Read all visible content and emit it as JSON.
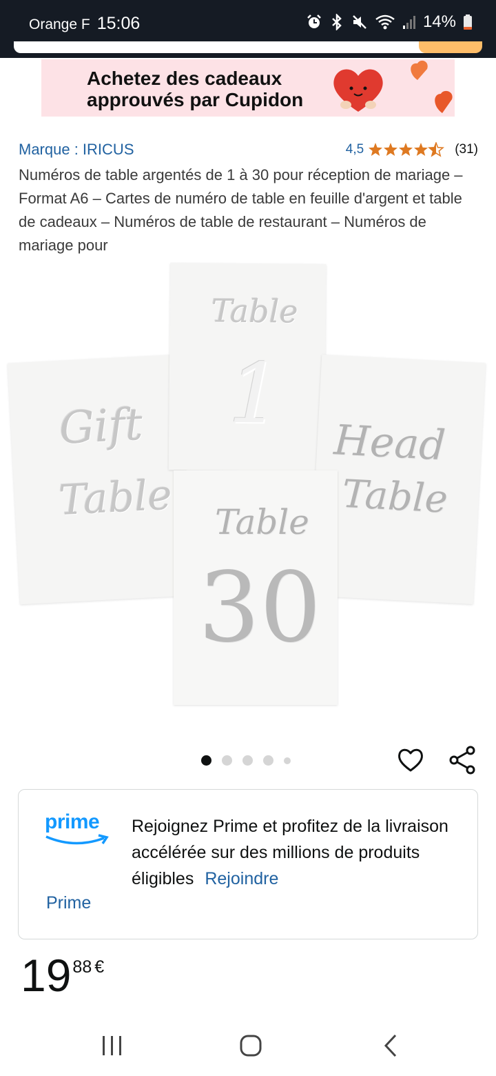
{
  "status_bar": {
    "carrier": "Orange F",
    "time": "15:06",
    "battery": "14%"
  },
  "promo": {
    "text": "Achetez des cadeaux\napprouvés par Cupidon"
  },
  "product": {
    "brand": "Marque : IRICUS",
    "rating_value": "4,5",
    "rating_stars": 4.5,
    "rating_count": "(31)",
    "title": "Numéros de table argentés de 1 à 30 pour réception de mariage – Format A6 – Cartes de numéro de table en feuille d'argent et table de cadeaux – Numéros de table de restaurant – Numéros de mariage pour",
    "image_cards": {
      "gift": [
        "Gift",
        "Table"
      ],
      "one": [
        "Table",
        "1"
      ],
      "head": [
        "Head",
        "Table"
      ],
      "thirty": [
        "Table",
        "30"
      ]
    },
    "carousel": {
      "count": 5,
      "active": 1
    }
  },
  "prime": {
    "logo": "prime",
    "message": "Rejoignez Prime et profitez de la livraison accélérée sur des millions de produits éligibles",
    "join_link": "Rejoindre",
    "label": "Prime"
  },
  "price": {
    "whole": "19",
    "fraction": "88",
    "currency": "€"
  },
  "colors": {
    "link": "#2162a1",
    "star": "#de7921",
    "prime_blue": "#1399ff",
    "status_bg": "#151b24",
    "search_button": "#febd69",
    "promo_bg": "#fde2e6"
  },
  "icons": [
    "alarm-icon",
    "bluetooth-icon",
    "mute-icon",
    "wifi-icon",
    "signal-icon",
    "battery-icon",
    "heart-icon",
    "share-icon",
    "recent-apps-icon",
    "home-icon",
    "back-icon"
  ]
}
